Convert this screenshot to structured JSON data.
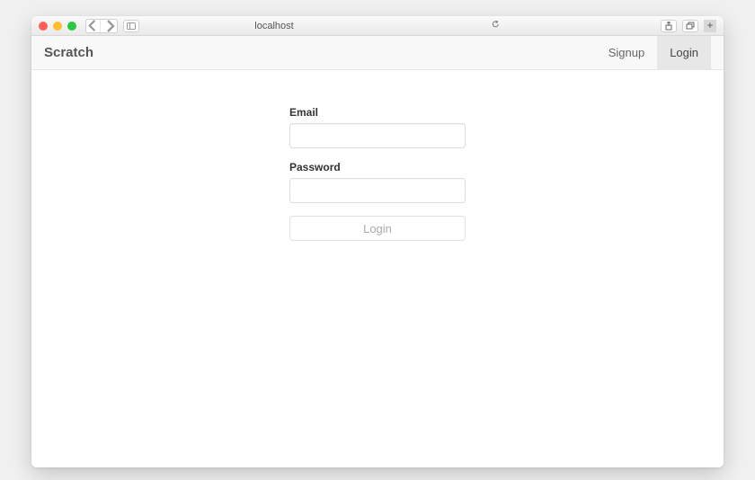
{
  "browser": {
    "url": "localhost"
  },
  "navbar": {
    "brand": "Scratch",
    "links": {
      "signup": "Signup",
      "login": "Login"
    }
  },
  "form": {
    "email_label": "Email",
    "email_value": "",
    "password_label": "Password",
    "password_value": "",
    "submit_label": "Login"
  }
}
